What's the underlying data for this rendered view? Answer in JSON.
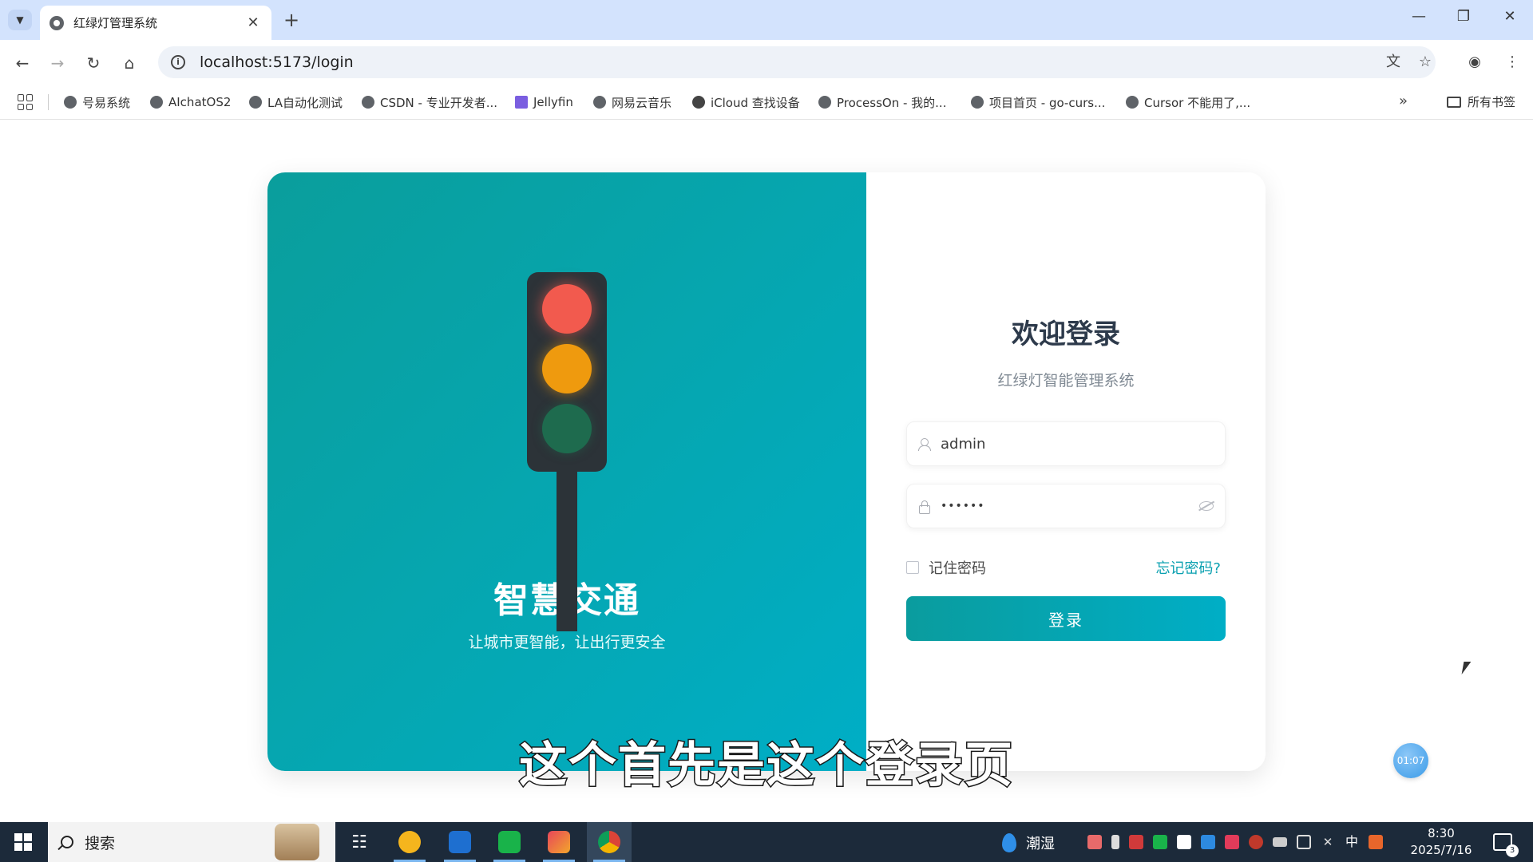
{
  "browser": {
    "tab_title": "红绿灯管理系统",
    "tab_close": "✕",
    "new_tab": "+",
    "url": "localhost:5173/login",
    "window_controls": {
      "minimize": "—",
      "restore": "❐",
      "close": "✕"
    }
  },
  "bookmarks": {
    "items": [
      {
        "label": "号易系统",
        "icon": "globe-icon"
      },
      {
        "label": "AIchatOS2",
        "icon": "openai-icon"
      },
      {
        "label": "LA自动化测试",
        "icon": "globe-icon"
      },
      {
        "label": "CSDN - 专业开发者...",
        "icon": "globe-icon"
      },
      {
        "label": "Jellyfin",
        "icon": "jellyfin-icon"
      },
      {
        "label": "网易云音乐",
        "icon": "globe-icon"
      },
      {
        "label": "iCloud 查找设备",
        "icon": "apple-icon"
      },
      {
        "label": "ProcessOn - 我的...",
        "icon": "globe-icon"
      },
      {
        "label": "项目首页 - go-curs...",
        "icon": "globe-icon"
      },
      {
        "label": "Cursor 不能用了,...",
        "icon": "globe-icon"
      }
    ],
    "more": "»",
    "all_bookmarks": "所有书签"
  },
  "hero": {
    "title": "智慧交通",
    "subtitle": "让城市更智能，让出行更安全"
  },
  "login": {
    "title": "欢迎登录",
    "subtitle": "红绿灯智能管理系统",
    "username_value": "admin",
    "password_value": "••••••",
    "remember_label": "记住密码",
    "forgot_label": "忘记密码?",
    "submit_label": "登录"
  },
  "timer": "01:07",
  "caption": "这个首先是这个登录页",
  "taskbar": {
    "search_label": "搜索",
    "weather": "潮湿",
    "time": "8:30",
    "date": "2025/7/16",
    "ime": "中",
    "notification_count": "3"
  },
  "colors": {
    "accent": "#0aa0b0",
    "panel_gradient_start": "#0a9e9c",
    "panel_gradient_end": "#00aec6",
    "light_red": "#f25a4e",
    "light_yellow": "#ef9a0e",
    "light_green": "#1e6b4e"
  }
}
